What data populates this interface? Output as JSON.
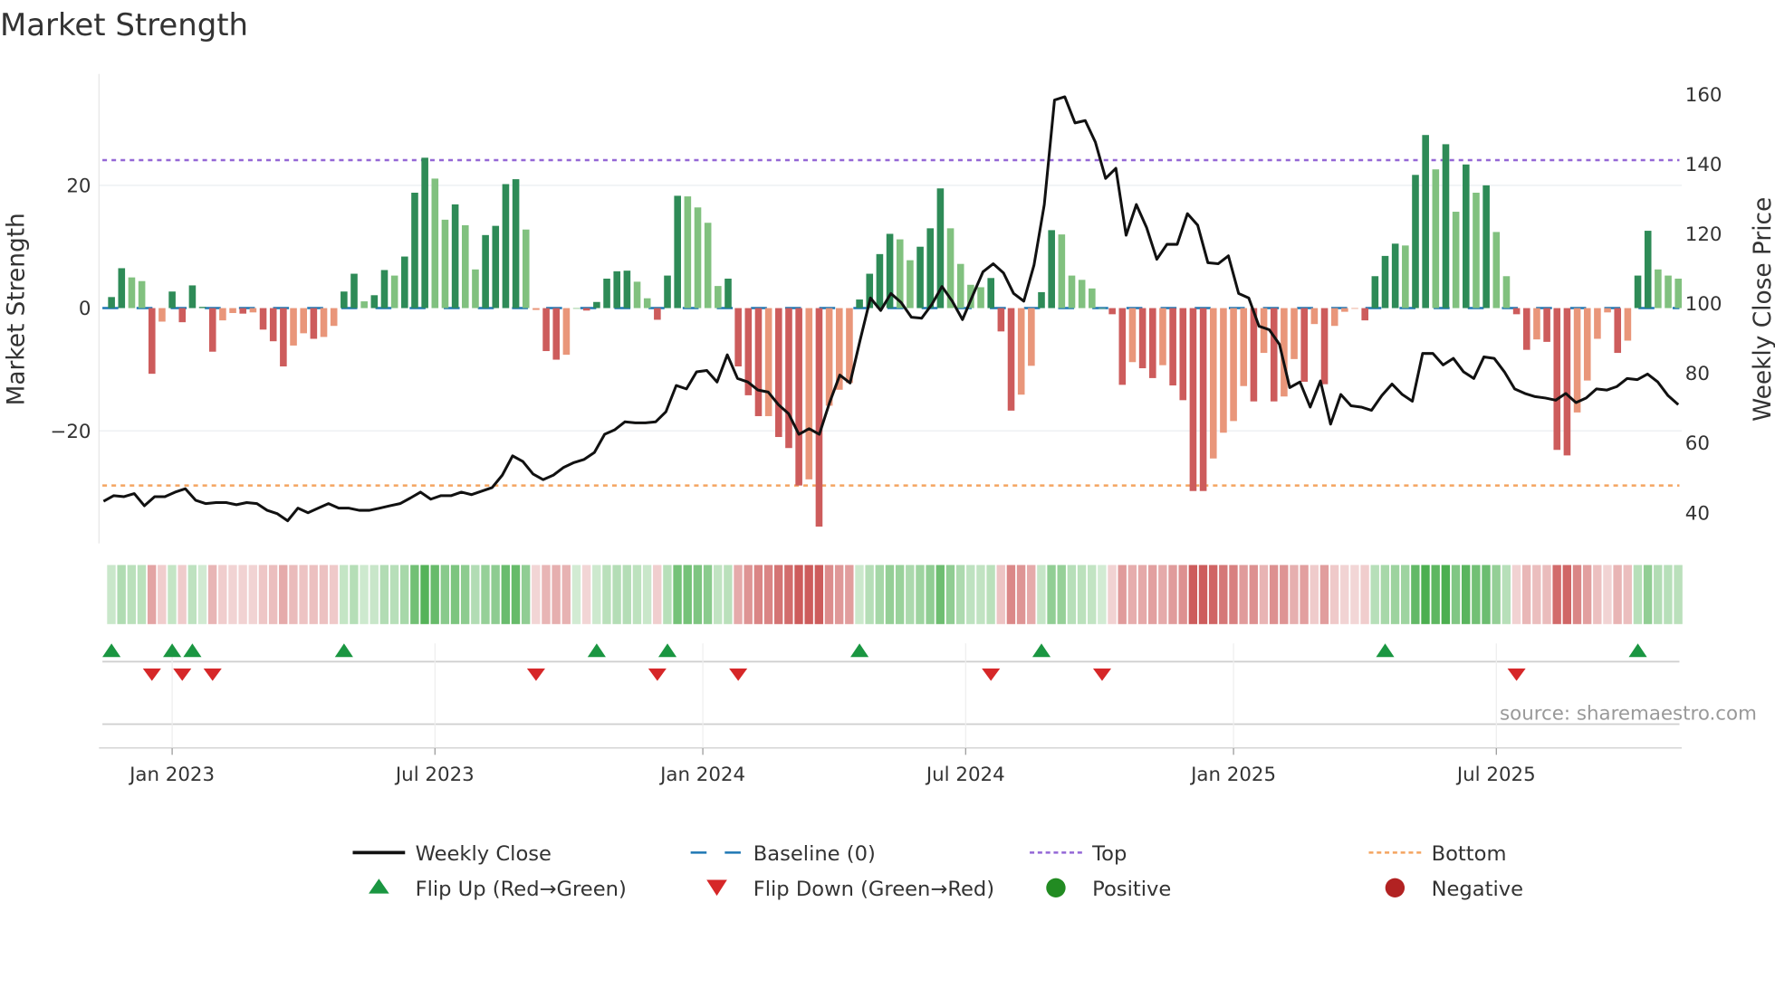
{
  "chart_data": {
    "type": "bar",
    "title": "Market Strength",
    "ylabel": "Market Strength",
    "y2label": "Weekly Close Price",
    "ylim": [
      -38,
      38
    ],
    "y2lim": [
      30,
      167
    ],
    "frequency": "weekly",
    "start_week": "2022-11-21",
    "left_ticks": [
      {
        "v": 20,
        "label": "20"
      },
      {
        "v": 0,
        "label": "0"
      },
      {
        "v": -20,
        "label": "−20"
      }
    ],
    "right_ticks": [
      {
        "v": 160,
        "label": "160"
      },
      {
        "v": 140,
        "label": "140"
      },
      {
        "v": 120,
        "label": "120"
      },
      {
        "v": 100,
        "label": "100"
      },
      {
        "v": 80,
        "label": "80"
      },
      {
        "v": 60,
        "label": "60"
      },
      {
        "v": 40,
        "label": "40"
      }
    ],
    "x_ticks": [
      {
        "week": 6,
        "label": "Jan 2023"
      },
      {
        "week": 32,
        "label": "Jul 2023"
      },
      {
        "week": 58.5,
        "label": "Jan 2024"
      },
      {
        "week": 84.5,
        "label": "Jul 2024"
      },
      {
        "week": 111,
        "label": "Jan 2025"
      },
      {
        "week": 137,
        "label": "Jul 2025"
      }
    ],
    "top_level": 24.1,
    "bottom_level": -28.9,
    "strength": [
      1.8,
      6.5,
      5.0,
      4.4,
      -10.7,
      -2.2,
      2.7,
      -2.3,
      3.7,
      0.2,
      -7.1,
      -2.0,
      -0.8,
      -0.9,
      -0.7,
      -3.5,
      -5.4,
      -9.5,
      -6.1,
      -4.1,
      -5.0,
      -4.7,
      -2.9,
      2.7,
      5.6,
      1.1,
      2.1,
      6.2,
      5.3,
      8.4,
      18.8,
      24.5,
      21.1,
      14.4,
      16.9,
      13.5,
      6.3,
      11.9,
      13.4,
      20.2,
      21.0,
      12.8,
      -0.3,
      -7.0,
      -8.4,
      -7.6,
      0,
      -0.4,
      1.0,
      4.8,
      6.0,
      6.1,
      4.3,
      1.6,
      -1.9,
      5.3,
      18.3,
      18.2,
      16.4,
      13.9,
      3.6,
      4.8,
      -9.5,
      -14.2,
      -17.6,
      -17.6,
      -21.0,
      -22.8,
      -28.9,
      -27.9,
      -35.6,
      -15.9,
      -13.3,
      -12.2,
      1.4,
      5.6,
      8.8,
      12.1,
      11.2,
      7.8,
      10.0,
      13.0,
      19.5,
      13.0,
      7.2,
      3.8,
      3.4,
      4.9,
      -3.8,
      -16.7,
      -14.1,
      -9.4,
      2.6,
      12.7,
      12.0,
      5.3,
      4.6,
      3.2,
      0,
      -1.0,
      -12.5,
      -8.8,
      -9.8,
      -11.4,
      -9.3,
      -12.6,
      -15.0,
      -29.8,
      -29.8,
      -24.5,
      -20.3,
      -18.4,
      -12.7,
      -15.2,
      -7.3,
      -15.2,
      -14.4,
      -8.3,
      -12.0,
      -2.6,
      -12.4,
      -2.9,
      -0.6,
      -0.1,
      -2.0,
      5.2,
      8.5,
      10.5,
      10.2,
      21.7,
      28.2,
      22.6,
      26.7,
      15.7,
      23.4,
      18.8,
      20.0,
      12.4,
      5.2,
      -1.0,
      -6.8,
      -5.1,
      -5.5,
      -23.1,
      -24.0,
      -17.0,
      -11.8,
      -5.0,
      -0.7,
      -7.3,
      -5.3,
      5.3,
      12.6,
      6.3,
      5.3,
      4.8
    ],
    "strong": [
      1,
      1,
      0,
      0,
      1,
      0,
      1,
      1,
      1,
      1,
      1,
      0,
      0,
      1,
      0,
      1,
      1,
      1,
      0,
      0,
      1,
      0,
      0,
      1,
      1,
      0,
      1,
      1,
      0,
      1,
      1,
      1,
      0,
      0,
      1,
      0,
      0,
      1,
      1,
      1,
      1,
      0,
      0,
      1,
      1,
      0,
      0,
      1,
      1,
      1,
      1,
      1,
      0,
      0,
      1,
      1,
      1,
      0,
      0,
      0,
      0,
      1,
      1,
      1,
      1,
      0,
      1,
      1,
      1,
      0,
      1,
      0,
      0,
      0,
      1,
      1,
      1,
      1,
      0,
      0,
      1,
      1,
      1,
      0,
      0,
      0,
      0,
      1,
      1,
      1,
      0,
      0,
      1,
      1,
      0,
      0,
      0,
      0,
      0,
      1,
      1,
      0,
      1,
      1,
      0,
      1,
      1,
      1,
      1,
      0,
      0,
      0,
      0,
      1,
      0,
      1,
      0,
      0,
      1,
      0,
      1,
      0,
      0,
      0,
      1,
      1,
      1,
      1,
      0,
      1,
      1,
      0,
      1,
      0,
      1,
      0,
      1,
      0,
      0,
      1,
      1,
      0,
      1,
      1,
      1,
      0,
      0,
      0,
      0,
      1,
      0,
      1,
      1,
      0,
      0,
      0
    ],
    "weekly_close": [
      43.3,
      44.9,
      44.6,
      45.5,
      42.0,
      44.6,
      44.6,
      45.9,
      46.9,
      43.6,
      42.6,
      42.9,
      42.9,
      42.3,
      42.9,
      42.6,
      40.7,
      39.7,
      37.7,
      41.3,
      40.0,
      41.3,
      42.6,
      41.3,
      41.3,
      40.7,
      40.7,
      41.3,
      42.0,
      42.6,
      44.2,
      45.9,
      43.9,
      44.9,
      44.9,
      45.9,
      45.2,
      46.2,
      47.2,
      50.8,
      56.3,
      54.7,
      51.1,
      49.5,
      50.8,
      53.0,
      54.4,
      55.3,
      57.3,
      62.5,
      63.8,
      66.1,
      65.8,
      65.8,
      66.1,
      69.0,
      76.5,
      75.5,
      80.4,
      80.8,
      77.5,
      85.3,
      78.5,
      77.5,
      75.2,
      74.6,
      71.0,
      68.4,
      62.5,
      64.1,
      62.5,
      71.6,
      79.5,
      77.2,
      89.6,
      101.6,
      98.0,
      102.9,
      100.3,
      96.1,
      95.8,
      99.7,
      104.9,
      100.7,
      95.4,
      102.3,
      109.1,
      111.4,
      108.8,
      102.9,
      100.7,
      111.1,
      128.4,
      158.4,
      159.3,
      151.8,
      152.5,
      146.3,
      135.9,
      138.8,
      119.6,
      128.4,
      121.8,
      112.7,
      117.0,
      117.0,
      125.8,
      122.5,
      111.7,
      111.4,
      113.7,
      102.9,
      101.6,
      93.5,
      92.5,
      88.3,
      75.9,
      77.5,
      70.3,
      77.8,
      65.4,
      73.9,
      70.7,
      70.3,
      69.4,
      73.6,
      76.9,
      73.9,
      72.0,
      85.7,
      85.7,
      82.4,
      84.3,
      80.4,
      78.5,
      84.7,
      84.3,
      80.4,
      75.5,
      74.2,
      73.3,
      72.9,
      72.3,
      74.2,
      71.6,
      72.9,
      75.5,
      75.2,
      76.2,
      78.5,
      78.2,
      79.8,
      77.5,
      73.6,
      71.0
    ],
    "flip_up_weeks": [
      0,
      6,
      8,
      23,
      48,
      55,
      74,
      92,
      126,
      151
    ],
    "flip_down_weeks": [
      4,
      7,
      10,
      42,
      54,
      62,
      87,
      98,
      139
    ],
    "legend": {
      "placement": "bottom",
      "items": [
        {
          "label": "Weekly Close",
          "kind": "line"
        },
        {
          "label": "Baseline (0)",
          "kind": "dash"
        },
        {
          "label": "Top",
          "kind": "dot-top"
        },
        {
          "label": "Bottom",
          "kind": "dot-bottom"
        },
        {
          "label": "Flip Up (Red→Green)",
          "kind": "tri-up"
        },
        {
          "label": "Flip Down (Green→Red)",
          "kind": "tri-down"
        },
        {
          "label": "Positive",
          "kind": "dot-pos"
        },
        {
          "label": "Negative",
          "kind": "dot-neg"
        }
      ]
    },
    "source": "source: sharemaestro.com"
  },
  "colors": {
    "pos_strong": "#2e8b57",
    "pos_weak": "#81c17f",
    "neg_strong": "#cd5c5c",
    "neg_weak": "#e9967a",
    "baseline": "#1f77b4",
    "top": "#9467d6",
    "bottom": "#f4a460",
    "close": "#111111",
    "flip_up": "#1a9641",
    "flip_down": "#d62728",
    "positive_dot": "#228b22",
    "negative_dot": "#b22222"
  }
}
